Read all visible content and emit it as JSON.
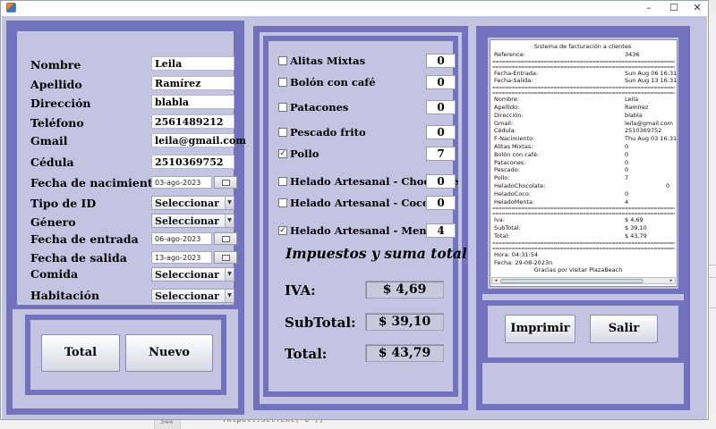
{
  "window": {
    "minimize": "–",
    "maximize": "☐",
    "close": "✕"
  },
  "background": {
    "code": "Txtpoll.setText(\"0\");",
    "line_no": "544"
  },
  "form": {
    "nombre": {
      "label": "Nombre",
      "value": "Leila"
    },
    "apellido": {
      "label": "Apellido",
      "value": "Ramírez"
    },
    "direccion": {
      "label": "Dirección",
      "value": "blabla"
    },
    "telefono": {
      "label": "Teléfono",
      "value": "2561489212"
    },
    "gmail": {
      "label": "Gmail",
      "value": "leila@gmail.com"
    },
    "cedula": {
      "label": "Cédula",
      "value": "2510369752"
    },
    "fecha_nacimiento": {
      "label": "Fecha de nacimiento",
      "value": "03-ago-2023"
    },
    "tipo_id": {
      "label": "Tipo de ID",
      "value": "Seleccionar"
    },
    "genero": {
      "label": "Género",
      "value": "Seleccionar"
    },
    "fecha_entrada": {
      "label": "Fecha de entrada",
      "value": "06-ago-2023"
    },
    "fecha_salida": {
      "label": "Fecha de salida",
      "value": "13-ago-2023"
    },
    "comida": {
      "label": "Comida",
      "value": "Seleccionar"
    },
    "habitacion": {
      "label": "Habitación",
      "value": "Seleccionar"
    }
  },
  "buttons": {
    "total": "Total",
    "nuevo": "Nuevo",
    "imprimir": "Imprimir",
    "salir": "Salir"
  },
  "menu": [
    {
      "name": "Alitas Mixtas",
      "checked": false,
      "qty": "0"
    },
    {
      "name": "Bolón con café",
      "checked": false,
      "qty": "0"
    },
    {
      "name": "Patacones",
      "checked": false,
      "qty": "0"
    },
    {
      "name": "Pescado frito",
      "checked": false,
      "qty": "0"
    },
    {
      "name": "Pollo",
      "checked": true,
      "qty": "7"
    },
    {
      "name": "Helado Artesanal - Chocolate",
      "checked": false,
      "qty": "0"
    },
    {
      "name": "Helado Artesanal - Coco",
      "checked": false,
      "qty": "0"
    },
    {
      "name": "Helado Artesanal - Menta",
      "checked": true,
      "qty": "4"
    }
  ],
  "taxes": {
    "title": "Impuestos y suma total",
    "iva_label": "IVA:",
    "iva_value": "$ 4,69",
    "subtotal_label": "SubTotal:",
    "subtotal_value": "$ 39,10",
    "total_label": "Total:",
    "total_value": "$ 43,79"
  },
  "receipt": {
    "title": "Sistema de facturación a clientes",
    "separator": "========================================================================",
    "reference": [
      "Reference:",
      "3436"
    ],
    "dates": [
      [
        "Fecha-Entrada:",
        "Sun Aug 06 16:31:3"
      ],
      [
        "Fecha-Salida:",
        "Sun Aug 13 16:31:4"
      ]
    ],
    "client": [
      [
        "Nombre:",
        "Leila"
      ],
      [
        "Apellido:",
        "Ramírez"
      ],
      [
        "Dirección:",
        "blabla"
      ],
      [
        "Gmail:",
        "leila@gmail.com"
      ],
      [
        "Cédula:",
        "2510369752"
      ],
      [
        "F-Nacimiento:",
        "Thu Aug 03 16:31:3"
      ],
      [
        "Alitas Mixtas:",
        "0"
      ],
      [
        "Bolón con café:",
        "0"
      ],
      [
        "Patacones:",
        "0"
      ],
      [
        "Pescado:",
        "0"
      ],
      [
        "Pollo:",
        "7"
      ],
      [
        "HeladoChocolate:",
        "0"
      ],
      [
        "HeladoCoco:",
        "0"
      ],
      [
        "HeladoMenta:",
        "4"
      ]
    ],
    "totals": [
      [
        "Iva:",
        "$ 4,69"
      ],
      [
        "SubTotal:",
        "$ 39,10"
      ],
      [
        "Total:",
        "$ 43,79"
      ]
    ],
    "hora": "Hora: 04:31:54",
    "fecha": "Fecha: 29-08-2023n",
    "footer": "Gracias por visitar PlazaBeach"
  }
}
